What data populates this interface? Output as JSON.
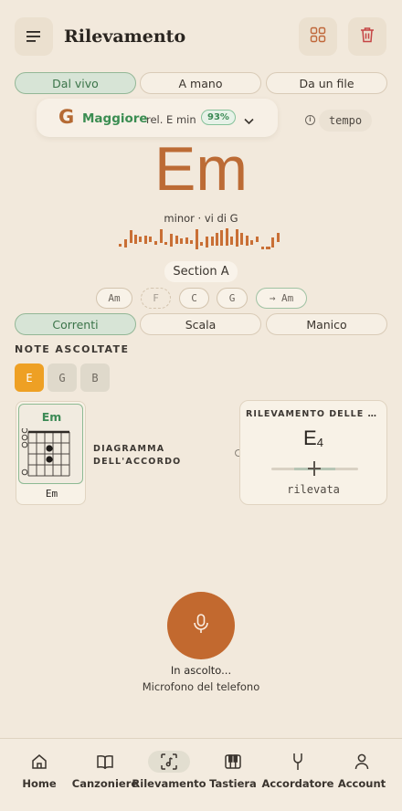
{
  "header": {
    "title": "Rilevamento",
    "menu_icon": "menu-icon",
    "grid_icon": "grid-icon",
    "delete_icon": "trash-icon"
  },
  "source_tabs": [
    {
      "label": "Dal vivo",
      "active": true
    },
    {
      "label": "A mano",
      "active": false
    },
    {
      "label": "Da un file",
      "active": false
    }
  ],
  "key": {
    "root": "G",
    "mode": "Maggiore",
    "relative": "rel. E min",
    "confidence": "93%"
  },
  "tempo_label": "tempo",
  "current_chord": {
    "name": "Em",
    "function": "minor · vi di G"
  },
  "section_label": "Section A",
  "progression": [
    "Am",
    "F",
    "C",
    "G",
    "→ Am"
  ],
  "view_tabs": [
    {
      "label": "Correnti",
      "active": true
    },
    {
      "label": "Scala",
      "active": false
    },
    {
      "label": "Manico",
      "active": false
    }
  ],
  "heard_notes": {
    "title": "NOTE ASCOLTATE",
    "notes": [
      {
        "label": "E",
        "active": true
      },
      {
        "label": "G",
        "active": false
      },
      {
        "label": "B",
        "active": false
      }
    ]
  },
  "chord_diagram": {
    "title": "Em",
    "name": "Em",
    "label": "DIAGRAMMA DELL'ACCORDO"
  },
  "note_detection": {
    "title": "RILEVAMENTO DELLE NOTE",
    "note": "E",
    "octave": "4",
    "status": "rilevata"
  },
  "listening": {
    "status": "In ascolto...",
    "source": "Microfono del telefono",
    "icon": "microphone-icon"
  },
  "bottom_nav": [
    {
      "label": "Home",
      "icon": "home-icon",
      "active": false
    },
    {
      "label": "Canzoniere",
      "icon": "book-icon",
      "active": false
    },
    {
      "label": "Rilevamento",
      "icon": "detect-icon",
      "active": true
    },
    {
      "label": "Tastiera",
      "icon": "piano-icon",
      "active": false
    },
    {
      "label": "Accordatore",
      "icon": "tuning-fork-icon",
      "active": false
    },
    {
      "label": "Account",
      "icon": "user-icon",
      "active": false
    }
  ],
  "colors": {
    "background": "#f2e9dc",
    "accent": "#bc6b35",
    "green": "#3b8d52",
    "highlight": "#eea024"
  }
}
